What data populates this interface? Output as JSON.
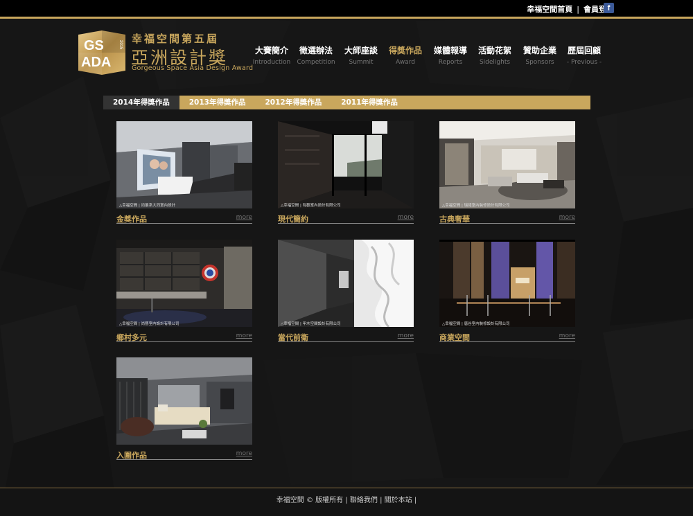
{
  "topbar": {
    "home_link": "幸福空間首頁",
    "separator": "|",
    "login_link": "會員登入",
    "facebook_icon": "f"
  },
  "logo": {
    "badge_line1": "GS",
    "badge_line2": "ADA",
    "badge_year": "2015",
    "title_line1": "幸福空間第五屆",
    "title_line2": "亞洲設計獎",
    "subtitle": "Gorgeous Space Asia Design Award"
  },
  "nav": [
    {
      "zh": "大賽簡介",
      "en": "Introduction"
    },
    {
      "zh": "徵選辦法",
      "en": "Competition"
    },
    {
      "zh": "大師座談",
      "en": "Summit"
    },
    {
      "zh": "得獎作品",
      "en": "Award"
    },
    {
      "zh": "媒體報導",
      "en": "Reports"
    },
    {
      "zh": "活動花絮",
      "en": "Sidelights"
    },
    {
      "zh": "贊助企業",
      "en": "Sponsors"
    },
    {
      "zh": "歷屆回顧",
      "en": "- Previous -"
    }
  ],
  "nav_active_index": 3,
  "tabs": [
    "2014年得獎作品",
    "2013年得獎作品",
    "2012年得獎作品",
    "2011年得獎作品"
  ],
  "tab_active_index": 0,
  "cards": [
    {
      "title": "金獎作品",
      "more": "more",
      "watermark": "△幸福空間 | 尚展系大同室內設計"
    },
    {
      "title": "現代簡約",
      "more": "more",
      "watermark": "△幸福空間 | 有觀室內設計有限公司"
    },
    {
      "title": "古典奢華",
      "more": "more",
      "watermark": "△幸福空間 | 瑞諾室內裝修設計有限公司"
    },
    {
      "title": "鄉村多元",
      "more": "more",
      "watermark": "△幸福空間 | 尚藝室內設計有限公司"
    },
    {
      "title": "當代前衛",
      "more": "more",
      "watermark": "△幸福空間 | 甲木空間設計有限公司"
    },
    {
      "title": "商業空間",
      "more": "more",
      "watermark": "△幸福空間 | 唐谷室內裝修設計有限公司"
    },
    {
      "title": "入圍作品",
      "more": "more",
      "watermark": ""
    }
  ],
  "footer": {
    "copyright": "幸福空間 © 版權所有 |",
    "contact": "聯絡我們",
    "sep": "|",
    "about": "關於本站",
    "end": "|"
  },
  "colors": {
    "gold": "#c9a75d",
    "background": "#151515",
    "topbar": "#000000",
    "facebook": "#3b5998"
  }
}
